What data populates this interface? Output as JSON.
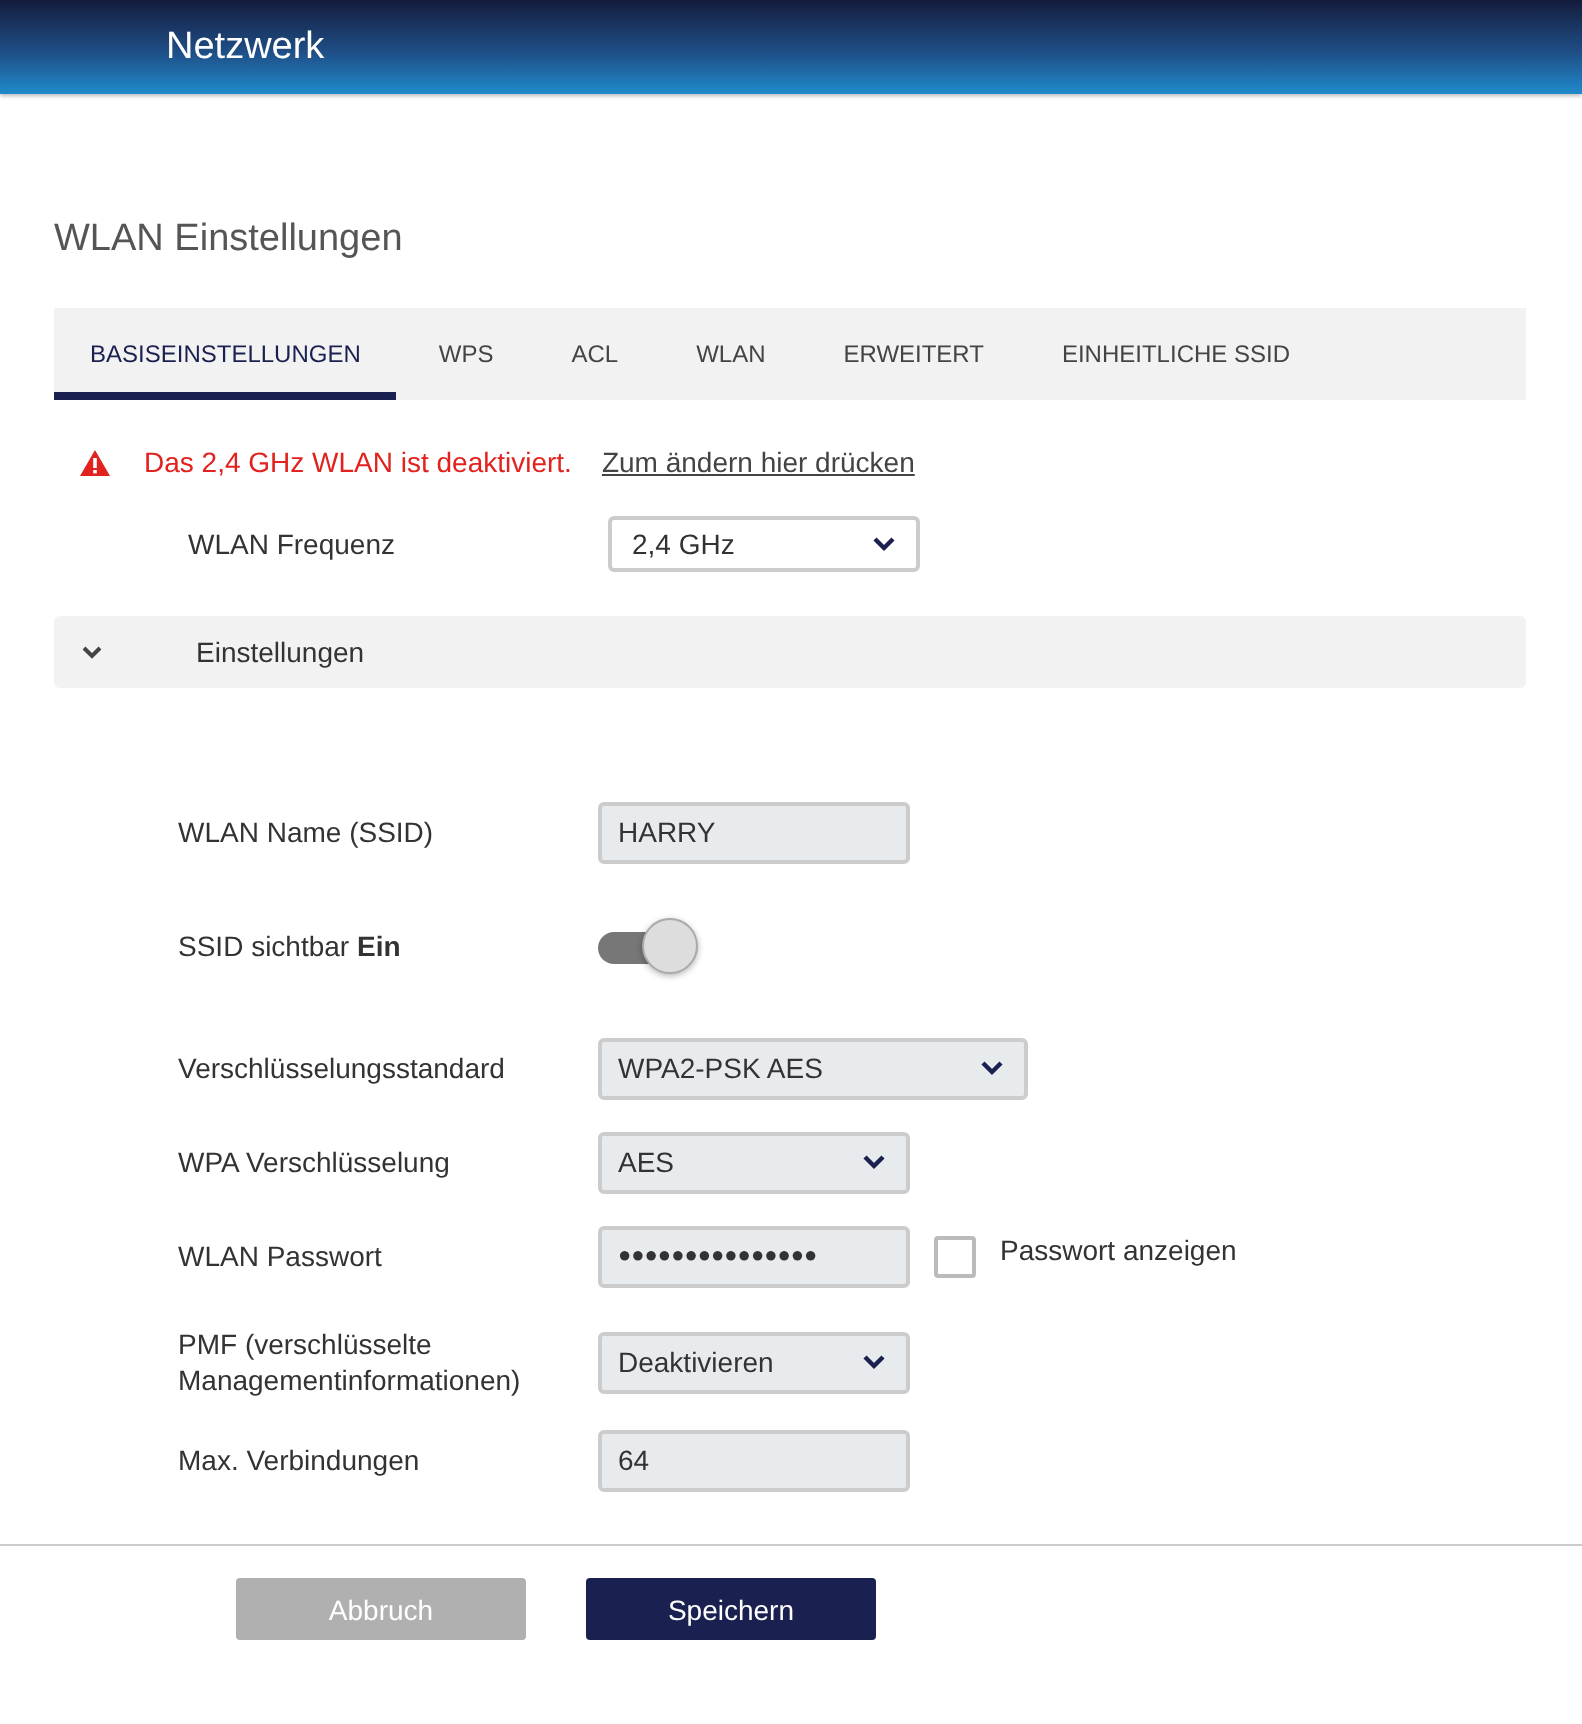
{
  "header": {
    "title": "Netzwerk"
  },
  "page_title": "WLAN Einstellungen",
  "tabs": [
    {
      "label": "BASISEINSTELLUNGEN",
      "selected": true
    },
    {
      "label": "WPS",
      "selected": false
    },
    {
      "label": "ACL",
      "selected": false
    },
    {
      "label": "WLAN",
      "selected": false
    },
    {
      "label": "ERWEITERT",
      "selected": false
    },
    {
      "label": "EINHEITLICHE SSID",
      "selected": false
    }
  ],
  "warning": {
    "text": "Das 2,4 GHz WLAN ist deaktiviert.",
    "link": "Zum ändern hier drücken"
  },
  "frequency": {
    "label": "WLAN Frequenz",
    "value": "2,4 GHz"
  },
  "section": {
    "title": "Einstellungen",
    "expanded": true
  },
  "fields": [
    {
      "kind": "text",
      "label": "WLAN Name (SSID)",
      "value": "HARRY"
    },
    {
      "kind": "toggle",
      "label": "SSID sichtbar **Ein**",
      "on": true
    },
    {
      "kind": "select",
      "label": "Verschlüsselungsstandard",
      "value": "WPA2-PSK AES",
      "wide": true
    },
    {
      "kind": "select",
      "label": "WPA Verschlüsselung",
      "value": "AES"
    },
    {
      "kind": "password",
      "label": "WLAN Passwort",
      "value": "●●●●●●●●●●●●●●●",
      "checkbox_label": "Passwort anzeigen",
      "checked": false
    },
    {
      "kind": "select",
      "label": "PMF (verschlüsselte Managementinformationen)",
      "value": "Deaktivieren"
    },
    {
      "kind": "text",
      "label": "Max. Verbindungen",
      "value": "64"
    }
  ],
  "buttons": [
    {
      "label": "Abbruch",
      "disabled": true
    },
    {
      "label": "Speichern",
      "disabled": false
    }
  ]
}
